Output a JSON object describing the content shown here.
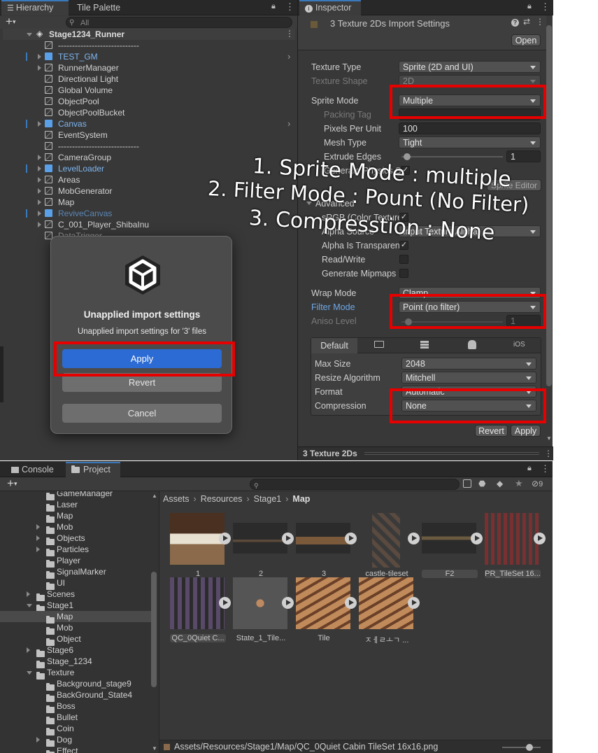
{
  "hierarchy": {
    "tab_label": "Hierarchy",
    "tab2_label": "Tile Palette",
    "search_placeholder": "All",
    "scene_name": "Stage1234_Runner",
    "items": [
      {
        "label": "-----------------------------"
      },
      {
        "label": "TEST_GM"
      },
      {
        "label": "RunnerManager"
      },
      {
        "label": "Directional Light"
      },
      {
        "label": "Global Volume"
      },
      {
        "label": "ObjectPool"
      },
      {
        "label": "ObjectPoolBucket"
      },
      {
        "label": "Canvas"
      },
      {
        "label": "EventSystem"
      },
      {
        "label": "-----------------------------"
      },
      {
        "label": "CameraGroup"
      },
      {
        "label": "LevelLoader"
      },
      {
        "label": "Areas"
      },
      {
        "label": "MobGenerator"
      },
      {
        "label": "Map"
      },
      {
        "label": "ReviveCanvas"
      },
      {
        "label": "C_001_Player_ShibaInu"
      },
      {
        "label": "DataTrigger"
      }
    ]
  },
  "inspector": {
    "tab_label": "Inspector",
    "title": "3 Texture 2Ds Import Settings",
    "open_button": "Open",
    "rows": {
      "texture_type": {
        "label": "Texture Type",
        "value": "Sprite (2D and UI)"
      },
      "texture_shape": {
        "label": "Texture Shape",
        "value": "2D"
      },
      "sprite_mode": {
        "label": "Sprite Mode",
        "value": "Multiple"
      },
      "packing_tag": {
        "label": "Packing Tag",
        "value": ""
      },
      "pixels_per_unit": {
        "label": "Pixels Per Unit",
        "value": "100"
      },
      "mesh_type": {
        "label": "Mesh Type",
        "value": "Tight"
      },
      "extrude_edges": {
        "label": "Extrude Edges",
        "value": "1"
      },
      "generate_physics": {
        "label": "Generate Physics S"
      },
      "sprite_editor": "Sprite Editor",
      "advanced": "Advanced",
      "srgb": {
        "label": "sRGB (Color Texture"
      },
      "alpha_source": {
        "label": "Alpha Source",
        "value": "Input Texture Alpha"
      },
      "alpha_transparency": {
        "label": "Alpha Is Transparen"
      },
      "read_write": {
        "label": "Read/Write"
      },
      "generate_mipmaps": {
        "label": "Generate Mipmaps"
      },
      "wrap_mode": {
        "label": "Wrap Mode",
        "value": "Clamp"
      },
      "filter_mode": {
        "label": "Filter Mode",
        "value": "Point (no filter)"
      },
      "aniso_level": {
        "label": "Aniso Level",
        "value": "1"
      }
    },
    "platform_tabs": [
      "Default",
      "iOS"
    ],
    "platform": {
      "max_size": {
        "label": "Max Size",
        "value": "2048"
      },
      "resize": {
        "label": "Resize Algorithm",
        "value": "Mitchell"
      },
      "format": {
        "label": "Format",
        "value": "Automatic"
      },
      "compression": {
        "label": "Compression",
        "value": "None"
      }
    },
    "revert_button": "Revert",
    "apply_button": "Apply",
    "footer": "3 Texture 2Ds"
  },
  "annotations": {
    "line1": "1. Sprite Mode : multiple",
    "line2": "2. Filter Mode : Pount (No Filter)",
    "line3": "3. Compresstion : None"
  },
  "dialog": {
    "title": "Unapplied import settings",
    "message": "Unapplied import settings for '3' files",
    "apply": "Apply",
    "revert": "Revert",
    "cancel": "Cancel"
  },
  "project": {
    "tab_console": "Console",
    "tab_project": "Project",
    "hidden_count": "9",
    "breadcrumb": [
      "Assets",
      "Resources",
      "Stage1",
      "Map"
    ],
    "tree": [
      {
        "label": "GameManager"
      },
      {
        "label": "Laser"
      },
      {
        "label": "Map"
      },
      {
        "label": "Mob"
      },
      {
        "label": "Objects"
      },
      {
        "label": "Particles"
      },
      {
        "label": "Player"
      },
      {
        "label": "SignalMarker"
      },
      {
        "label": "UI"
      },
      {
        "label": "Scenes"
      },
      {
        "label": "Stage1"
      },
      {
        "label": "Map"
      },
      {
        "label": "Mob"
      },
      {
        "label": "Object"
      },
      {
        "label": "Stage6"
      },
      {
        "label": "Stage_1234"
      },
      {
        "label": "Texture"
      },
      {
        "label": "Background_stage9"
      },
      {
        "label": "BackGround_State4"
      },
      {
        "label": "Boss"
      },
      {
        "label": "Bullet"
      },
      {
        "label": "Coin"
      },
      {
        "label": "Dog"
      },
      {
        "label": "Effect"
      }
    ],
    "assets": [
      {
        "name": "1"
      },
      {
        "name": "2"
      },
      {
        "name": "3"
      },
      {
        "name": "castle-tileset"
      },
      {
        "name": "F2"
      },
      {
        "name": "PR_TileSet 16..."
      },
      {
        "name": "QC_0Quiet C..."
      },
      {
        "name": "State_1_Tile..."
      },
      {
        "name": "Tile"
      },
      {
        "name": "ㅈㅔㄹㅗㄱ ..."
      }
    ],
    "status_path": "Assets/Resources/Stage1/Map/QC_0Quiet Cabin TileSet 16x16.png"
  },
  "colors": {
    "accent": "#3a79bb",
    "highlight_box": "#e60000",
    "apply_button": "#2c6bd4"
  }
}
